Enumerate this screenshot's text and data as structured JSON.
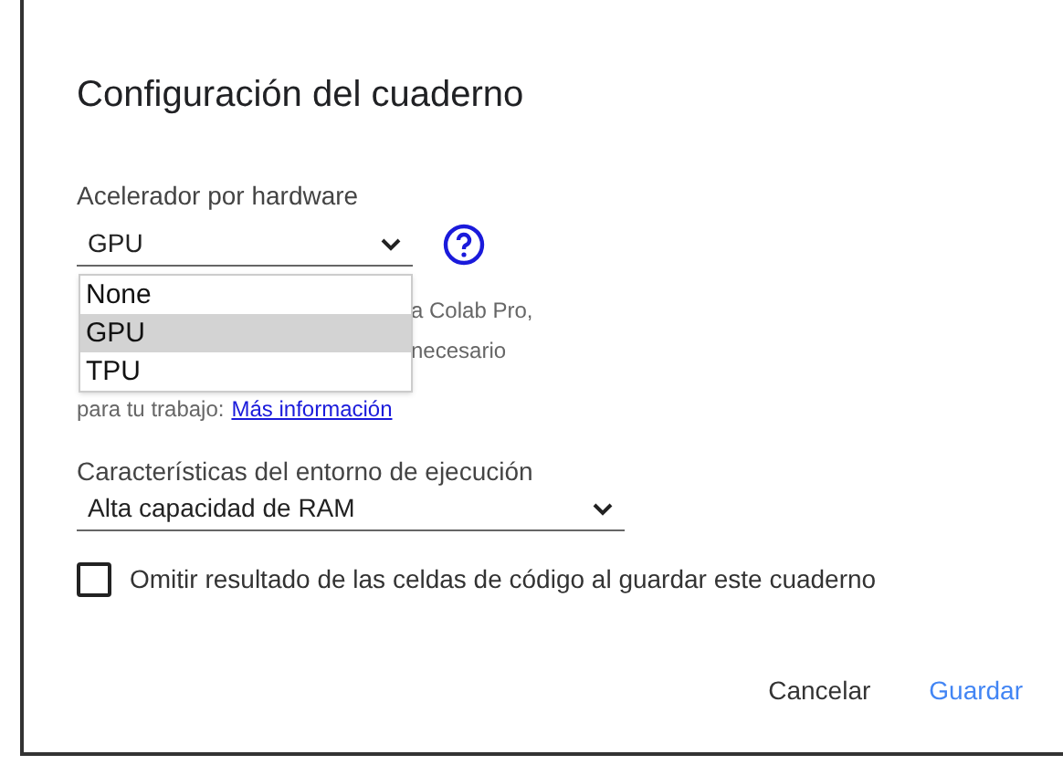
{
  "dialog": {
    "title": "Configuración del cuaderno",
    "accelerator": {
      "label": "Acelerador por hardware",
      "value": "GPU",
      "expanded": true,
      "options": [
        {
          "label": "None",
          "selected": false
        },
        {
          "label": "GPU",
          "selected": true
        },
        {
          "label": "TPU",
          "selected": false
        }
      ]
    },
    "description": {
      "fragments": [
        "a Colab Pro,",
        "necesario"
      ],
      "last_line": "para tu trabajo:",
      "link": "Más información"
    },
    "runtime": {
      "label": "Características del entorno de ejecución",
      "value": "Alta capacidad de RAM"
    },
    "omit_output": {
      "label": "Omitir resultado de las celdas de código al guardar este cuaderno",
      "checked": false
    },
    "buttons": [
      {
        "label": "Cancelar",
        "kind": "text"
      },
      {
        "label": "Guardar",
        "kind": "primary"
      }
    ]
  }
}
